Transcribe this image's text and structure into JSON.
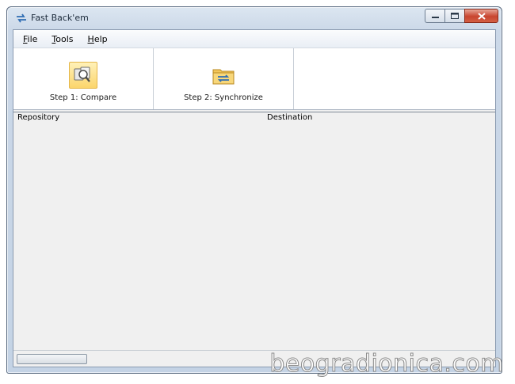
{
  "window": {
    "title": "Fast Back'em",
    "app_icon": "sync-arrows-icon",
    "controls": {
      "minimize": "minimize-icon",
      "maximize": "maximize-icon",
      "close": "close-icon"
    }
  },
  "menu": {
    "items": [
      {
        "mnemonic": "F",
        "rest": "ile"
      },
      {
        "mnemonic": "T",
        "rest": "ools"
      },
      {
        "mnemonic": "H",
        "rest": "elp"
      }
    ]
  },
  "toolbar": {
    "compare": {
      "label": "Step 1: Compare",
      "icon": "compare-icon",
      "state": "hover"
    },
    "synchronize": {
      "label": "Step 2: Synchronize",
      "icon": "sync-folder-icon"
    }
  },
  "grid": {
    "columns": [
      "Repository",
      "Destination"
    ]
  },
  "watermark": "beogradionica.com",
  "colors": {
    "hover_fill": "#fbd56c",
    "title_bar": "#cbd8e8",
    "close_button": "#c8452f"
  }
}
